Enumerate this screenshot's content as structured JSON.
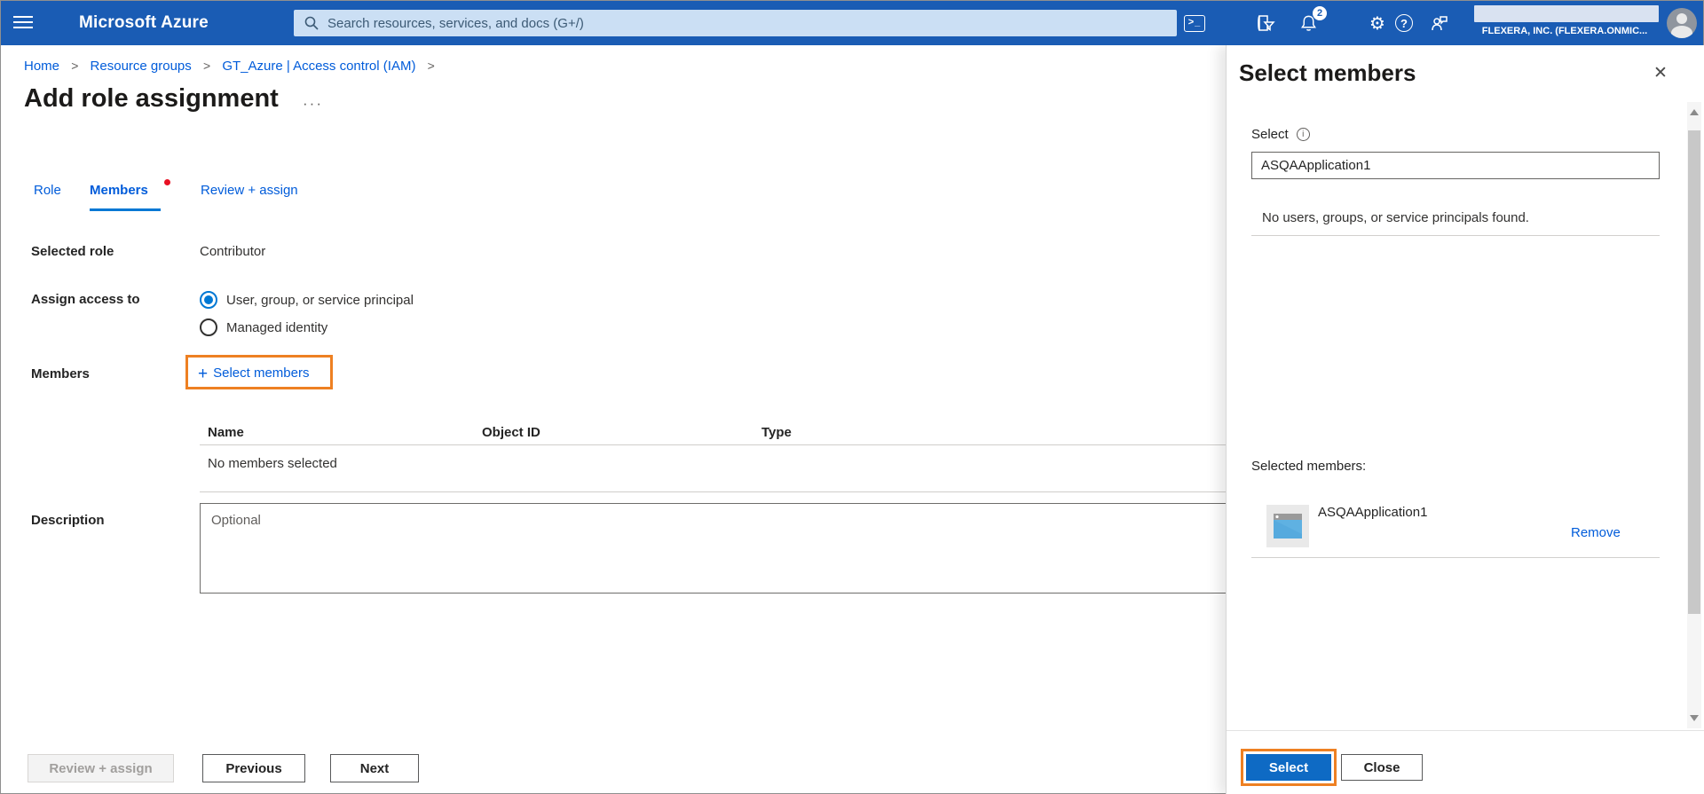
{
  "header": {
    "app_title": "Microsoft Azure",
    "search_placeholder": "Search resources, services, and docs (G+/)",
    "notification_count": "2",
    "tenant": "FLEXERA, INC. (FLEXERA.ONMIC...",
    "icons": {
      "terminal": ">_",
      "gear": "⚙",
      "help": "?"
    },
    "colors": {
      "topbar": "#1a5cb4",
      "accent_blue": "#015cda",
      "primary_button": "#0e6ac4",
      "annotation_orange": "#ee8022"
    }
  },
  "breadcrumb": {
    "separator": ">",
    "items": [
      "Home",
      "Resource groups",
      "GT_Azure | Access control (IAM)"
    ]
  },
  "page": {
    "title": "Add role assignment",
    "more_label": "···"
  },
  "tabs": [
    {
      "label": "Role",
      "active": false
    },
    {
      "label": "Members",
      "active": true
    },
    {
      "label": "Review + assign",
      "active": false
    }
  ],
  "form": {
    "selected_role_label": "Selected role",
    "selected_role_value": "Contributor",
    "assign_access_label": "Assign access to",
    "radio_options": [
      "User, group, or service principal",
      "Managed identity"
    ],
    "members_label": "Members",
    "plus_icon": "+",
    "select_members_button": "Select members",
    "table": {
      "headers": [
        "Name",
        "Object ID",
        "Type"
      ],
      "empty_text": "No members selected"
    },
    "description_label": "Description",
    "description_placeholder": "Optional"
  },
  "footer": {
    "review_assign_label": "Review + assign",
    "previous_label": "Previous",
    "next_label": "Next"
  },
  "panel": {
    "title": "Select members",
    "close_icon": "✕",
    "select_label": "Select",
    "info_icon": "i",
    "search_value": "ASQAApplication1",
    "no_results": "No users, groups, or service principals found.",
    "selected_members_label": "Selected members:",
    "members": [
      {
        "name": "ASQAApplication1",
        "remove_label": "Remove"
      }
    ],
    "select_button": "Select",
    "close_button": "Close"
  }
}
